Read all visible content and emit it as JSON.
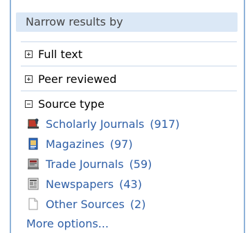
{
  "panel": {
    "title": "Narrow results by",
    "facets": [
      {
        "label": "Full text",
        "expanded": false
      },
      {
        "label": "Peer reviewed",
        "expanded": false
      },
      {
        "label": "Source type",
        "expanded": true
      }
    ],
    "source_types": [
      {
        "label": "Scholarly Journals",
        "count": "(917)",
        "icon": "scholarly-journals-icon"
      },
      {
        "label": "Magazines",
        "count": "(97)",
        "icon": "magazine-icon"
      },
      {
        "label": "Trade Journals",
        "count": "(59)",
        "icon": "trade-journals-icon"
      },
      {
        "label": "Newspapers",
        "count": "(43)",
        "icon": "newspaper-icon"
      },
      {
        "label": "Other Sources",
        "count": "(2)",
        "icon": "document-icon"
      }
    ],
    "more_options": "More options..."
  },
  "colors": {
    "header_bg": "#dbe8f6",
    "border": "#8fb3d9",
    "link": "#2e5fa7"
  }
}
